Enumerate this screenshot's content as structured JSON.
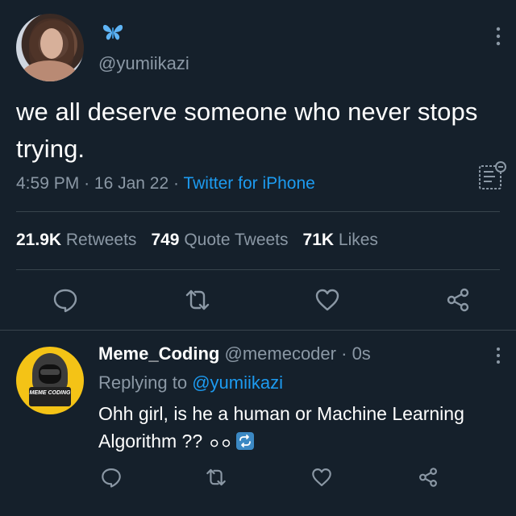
{
  "tweet": {
    "handle": "@yumiikazi",
    "text": "we all deserve someone who never stops trying.",
    "time": "4:59 PM",
    "date": "16 Jan 22",
    "source": "Twitter for iPhone",
    "stats": {
      "retweets_count": "21.9K",
      "retweets_label": "Retweets",
      "quotes_count": "749",
      "quotes_label": "Quote Tweets",
      "likes_count": "71K",
      "likes_label": "Likes"
    }
  },
  "reply": {
    "name": "Meme_Coding",
    "handle": "@memecoder",
    "time": "0s",
    "replying_label": "Replying to",
    "replying_to": "@yumiikazi",
    "text": "Ohh girl, is he a human or Machine Learning Algorithm ??",
    "avatar_text": "MEME CODING"
  },
  "icons": [
    "butterfly-icon",
    "more-icon",
    "document-icon",
    "reply-icon",
    "retweet-icon",
    "like-icon",
    "share-icon",
    "eyes-emoji",
    "repeat-emoji"
  ],
  "colors": {
    "background": "#15202b",
    "accent": "#1d9bf0",
    "muted": "#8b98a5",
    "divider": "#38444d"
  }
}
